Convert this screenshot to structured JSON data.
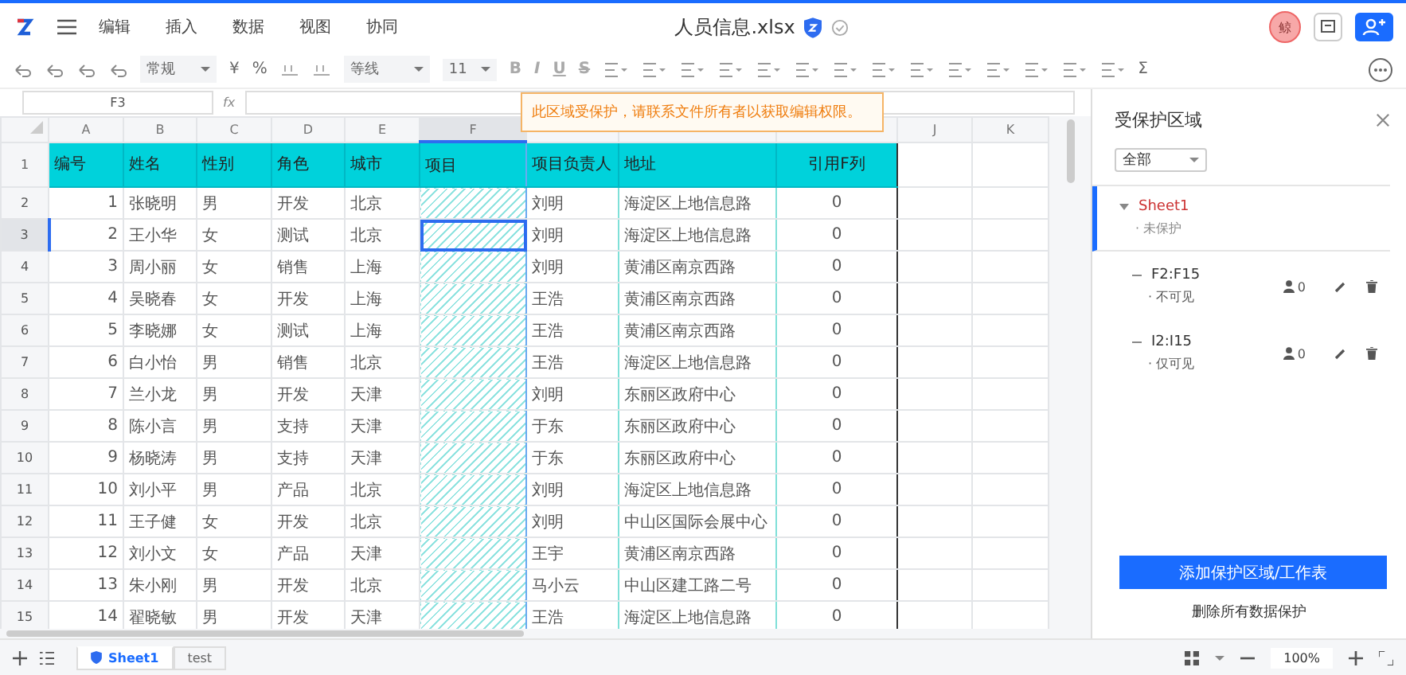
{
  "app": {
    "menu": [
      {
        "label": "编辑"
      },
      {
        "label": "插入"
      },
      {
        "label": "数据"
      },
      {
        "label": "视图"
      },
      {
        "label": "协同"
      }
    ],
    "title": "人员信息.xlsx",
    "avatar": "鲸"
  },
  "toolbar": {
    "number_format": "常规",
    "currency": "¥",
    "percent": "%",
    "font_name": "等线",
    "font_size": "11",
    "style_buttons": [
      "B",
      "I",
      "U",
      "S"
    ],
    "sum": "Σ"
  },
  "formula_bar": {
    "cell_ref": "F3",
    "fx": "fx"
  },
  "sheet": {
    "columns": [
      {
        "letter": "A",
        "header": "编号",
        "selected": false,
        "protected": false
      },
      {
        "letter": "B",
        "header": "姓名",
        "selected": false,
        "protected": false
      },
      {
        "letter": "C",
        "header": "性别",
        "selected": false,
        "protected": false
      },
      {
        "letter": "D",
        "header": "角色",
        "selected": false,
        "protected": false
      },
      {
        "letter": "E",
        "header": "城市",
        "selected": false,
        "protected": false
      },
      {
        "letter": "F",
        "header": "项目",
        "selected": true,
        "protected": true
      },
      {
        "header": "项目负责人",
        "selected": false,
        "protected": false
      },
      {
        "header": "地址",
        "selected": false,
        "protected": false
      },
      {
        "header": "引用F列",
        "selected": false,
        "protected": false
      },
      {
        "letter": "J",
        "selected": false,
        "protected": false
      },
      {
        "letter": "K",
        "selected": false,
        "protected": false
      }
    ],
    "header_row": "1",
    "rows": [
      {
        "number": "2",
        "selected": false,
        "cells": [
          "1",
          "张晓明",
          "男",
          "开发",
          "北京",
          "",
          "刘明",
          "海淀区上地信息路",
          "0"
        ]
      },
      {
        "number": "3",
        "selected": true,
        "cells": [
          "2",
          "王小华",
          "女",
          "测试",
          "北京",
          "",
          "刘明",
          "海淀区上地信息路",
          "0"
        ]
      },
      {
        "number": "4",
        "selected": false,
        "cells": [
          "3",
          "周小丽",
          "女",
          "销售",
          "上海",
          "",
          "刘明",
          "黄浦区南京西路",
          "0"
        ]
      },
      {
        "number": "5",
        "selected": false,
        "cells": [
          "4",
          "吴晓春",
          "女",
          "开发",
          "上海",
          "",
          "王浩",
          "黄浦区南京西路",
          "0"
        ]
      },
      {
        "number": "6",
        "selected": false,
        "cells": [
          "5",
          "李晓娜",
          "女",
          "测试",
          "上海",
          "",
          "王浩",
          "黄浦区南京西路",
          "0"
        ]
      },
      {
        "number": "7",
        "selected": false,
        "cells": [
          "6",
          "白小怡",
          "男",
          "销售",
          "北京",
          "",
          "王浩",
          "海淀区上地信息路",
          "0"
        ]
      },
      {
        "number": "8",
        "selected": false,
        "cells": [
          "7",
          "兰小龙",
          "男",
          "开发",
          "天津",
          "",
          "刘明",
          "东丽区政府中心",
          "0"
        ]
      },
      {
        "number": "9",
        "selected": false,
        "cells": [
          "8",
          "陈小言",
          "男",
          "支持",
          "天津",
          "",
          "于东",
          "东丽区政府中心",
          "0"
        ]
      },
      {
        "number": "10",
        "selected": false,
        "cells": [
          "9",
          "杨晓涛",
          "男",
          "支持",
          "天津",
          "",
          "于东",
          "东丽区政府中心",
          "0"
        ]
      },
      {
        "number": "11",
        "selected": false,
        "cells": [
          "10",
          "刘小平",
          "男",
          "产品",
          "北京",
          "",
          "刘明",
          "海淀区上地信息路",
          "0"
        ]
      },
      {
        "number": "12",
        "selected": false,
        "cells": [
          "11",
          "王子健",
          "女",
          "开发",
          "北京",
          "",
          "刘明",
          "中山区国际会展中心",
          "0"
        ]
      },
      {
        "number": "13",
        "selected": false,
        "cells": [
          "12",
          "刘小文",
          "女",
          "产品",
          "天津",
          "",
          "王宇",
          "黄浦区南京西路",
          "0"
        ]
      },
      {
        "number": "14",
        "selected": false,
        "cells": [
          "13",
          "朱小刚",
          "男",
          "开发",
          "北京",
          "",
          "马小云",
          "中山区建工路二号",
          "0"
        ]
      },
      {
        "number": "15",
        "selected": false,
        "cells": [
          "14",
          "翟晓敏",
          "男",
          "开发",
          "天津",
          "",
          "王浩",
          "海淀区上地信息路",
          "0"
        ]
      }
    ]
  },
  "tooltip": "此区域受保护，请联系文件所有者以获取编辑权限。",
  "panel": {
    "title": "受保护区域",
    "filter": "全部",
    "items": [
      {
        "kind": "sheet",
        "name": "Sheet1",
        "status": "· 未保护",
        "selected": true
      },
      {
        "kind": "range",
        "name": "F2:F15",
        "status": "· 不可见",
        "users": "0",
        "selected": false
      },
      {
        "kind": "range",
        "name": "I2:I15",
        "status": "· 仅可见",
        "users": "0",
        "selected": false
      }
    ],
    "add_button": "添加保护区域/工作表",
    "remove_link": "删除所有数据保护"
  },
  "sheet_tabs": [
    {
      "label": "Sheet1",
      "selected": true,
      "protected": true
    },
    {
      "label": "test",
      "selected": false,
      "protected": false
    }
  ],
  "zoom": "100%"
}
